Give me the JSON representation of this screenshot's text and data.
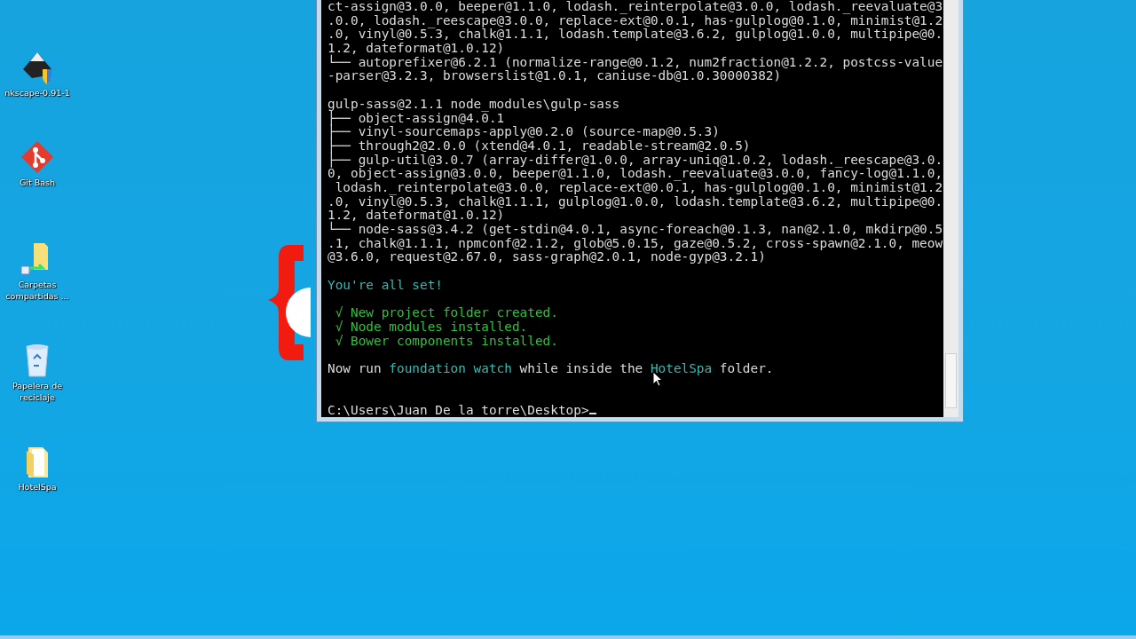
{
  "desktop_icons": [
    {
      "kind": "inkscape",
      "label": "nkscape-0.91-1"
    },
    {
      "kind": "git",
      "label": "Git Bash"
    },
    {
      "kind": "shared",
      "label": "Carpetas compartidas ..."
    },
    {
      "kind": "recycle",
      "label": "Papelera de reciclaje"
    },
    {
      "kind": "folder",
      "label": "HotelSpa"
    }
  ],
  "terminal": {
    "lines": [
      {
        "kind": "text",
        "segments": [
          {
            "text": "ct-assign@3.0.0, beeper@1.1.0, lodash._reinterpolate@3.0.0, lodash._reevaluate@3"
          }
        ]
      },
      {
        "kind": "text",
        "segments": [
          {
            "text": ".0.0, lodash._reescape@3.0.0, replace-ext@0.0.1, has-gulplog@0.1.0, minimist@1.2"
          }
        ]
      },
      {
        "kind": "text",
        "segments": [
          {
            "text": ".0, vinyl@0.5.3, chalk@1.1.1, lodash.template@3.6.2, gulplog@1.0.0, multipipe@0."
          }
        ]
      },
      {
        "kind": "text",
        "segments": [
          {
            "text": "1.2, dateformat@1.0.12)"
          }
        ]
      },
      {
        "kind": "text",
        "segments": [
          {
            "text": "└── autoprefixer@6.2.1 (normalize-range@0.1.2, num2fraction@1.2.2, postcss-value"
          }
        ]
      },
      {
        "kind": "text",
        "segments": [
          {
            "text": "-parser@3.2.3, browserslist@1.0.1, caniuse-db@1.0.30000382)"
          }
        ]
      },
      {
        "kind": "blank"
      },
      {
        "kind": "text",
        "segments": [
          {
            "text": "gulp-sass@2.1.1 node_modules\\gulp-sass"
          }
        ]
      },
      {
        "kind": "text",
        "segments": [
          {
            "text": "├── object-assign@4.0.1"
          }
        ]
      },
      {
        "kind": "text",
        "segments": [
          {
            "text": "├── vinyl-sourcemaps-apply@0.2.0 (source-map@0.5.3)"
          }
        ]
      },
      {
        "kind": "text",
        "segments": [
          {
            "text": "├── through2@2.0.0 (xtend@4.0.1, readable-stream@2.0.5)"
          }
        ]
      },
      {
        "kind": "text",
        "segments": [
          {
            "text": "├── gulp-util@3.0.7 (array-differ@1.0.0, array-uniq@1.0.2, lodash._reescape@3.0."
          }
        ]
      },
      {
        "kind": "text",
        "segments": [
          {
            "text": "0, object-assign@3.0.0, beeper@1.1.0, lodash._reevaluate@3.0.0, fancy-log@1.1.0,"
          }
        ]
      },
      {
        "kind": "text",
        "segments": [
          {
            "text": " lodash._reinterpolate@3.0.0, replace-ext@0.0.1, has-gulplog@0.1.0, minimist@1.2"
          }
        ]
      },
      {
        "kind": "text",
        "segments": [
          {
            "text": ".0, vinyl@0.5.3, chalk@1.1.1, gulplog@1.0.0, lodash.template@3.6.2, multipipe@0."
          }
        ]
      },
      {
        "kind": "text",
        "segments": [
          {
            "text": "1.2, dateformat@1.0.12)"
          }
        ]
      },
      {
        "kind": "text",
        "segments": [
          {
            "text": "└── node-sass@3.4.2 (get-stdin@4.0.1, async-foreach@0.1.3, nan@2.1.0, mkdirp@0.5"
          }
        ]
      },
      {
        "kind": "text",
        "segments": [
          {
            "text": ".1, chalk@1.1.1, npmconf@2.1.2, glob@5.0.15, gaze@0.5.2, cross-spawn@2.1.0, meow"
          }
        ]
      },
      {
        "kind": "text",
        "segments": [
          {
            "text": "@3.6.0, request@2.67.0, sass-graph@2.0.1, node-gyp@3.2.1)"
          }
        ]
      },
      {
        "kind": "blank"
      },
      {
        "kind": "text",
        "segments": [
          {
            "text": "You're all set!",
            "color": "#3ab8b0"
          }
        ]
      },
      {
        "kind": "blank"
      },
      {
        "kind": "text",
        "segments": [
          {
            "text": " √ New project folder created.",
            "color": "#2ec23a"
          }
        ]
      },
      {
        "kind": "text",
        "segments": [
          {
            "text": " √ Node modules installed.",
            "color": "#2ec23a"
          }
        ]
      },
      {
        "kind": "text",
        "segments": [
          {
            "text": " √ Bower components installed.",
            "color": "#2ec23a"
          }
        ]
      },
      {
        "kind": "blank"
      },
      {
        "kind": "text",
        "segments": [
          {
            "text": "Now run "
          },
          {
            "text": "foundation watch",
            "color": "#3ab8b0"
          },
          {
            "text": " while inside the "
          },
          {
            "text": "HotelSpa",
            "color": "#3ab8b0"
          },
          {
            "text": " folder."
          }
        ]
      },
      {
        "kind": "blank"
      },
      {
        "kind": "blank"
      },
      {
        "kind": "prompt",
        "segments": [
          {
            "text": "C:\\Users\\Juan De la torre\\Desktop>"
          }
        ]
      }
    ]
  }
}
